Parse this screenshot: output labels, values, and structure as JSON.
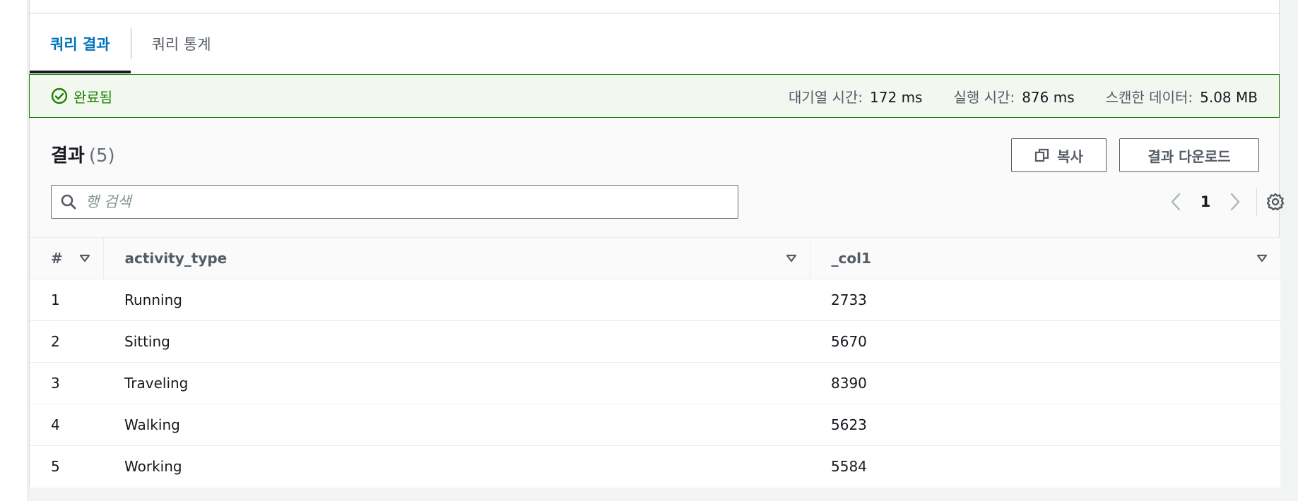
{
  "tabs": [
    {
      "label": "쿼리 결과",
      "active": true
    },
    {
      "label": "쿼리 통계",
      "active": false
    }
  ],
  "status": {
    "text": "완료됨",
    "color": "#1d8102",
    "queue_label": "대기열 시간:",
    "queue_value": "172 ms",
    "run_label": "실행 시간:",
    "run_value": "876 ms",
    "scan_label": "스캔한 데이터:",
    "scan_value": "5.08 MB"
  },
  "results": {
    "title": "결과",
    "count": "(5)",
    "copy_label": "복사",
    "download_label": "결과 다운로드",
    "search_placeholder": "행 검색",
    "page": "1"
  },
  "table": {
    "columns": [
      "#",
      "activity_type",
      "_col1"
    ],
    "rows": [
      [
        "1",
        "Running",
        "2733"
      ],
      [
        "2",
        "Sitting",
        "5670"
      ],
      [
        "3",
        "Traveling",
        "8390"
      ],
      [
        "4",
        "Walking",
        "5623"
      ],
      [
        "5",
        "Working",
        "5584"
      ]
    ]
  },
  "colors": {
    "accent": "#0073bb",
    "success": "#1d8102",
    "text": "#16191f",
    "muted": "#545b64"
  }
}
